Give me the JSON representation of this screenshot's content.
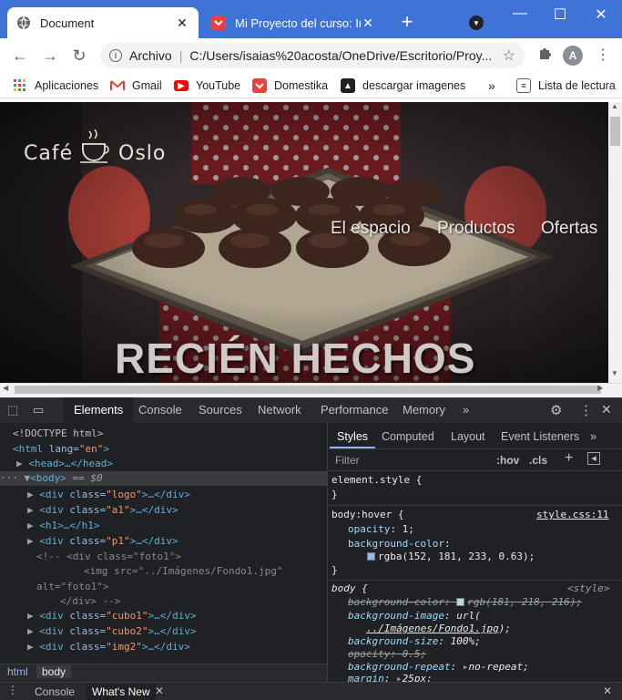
{
  "browser": {
    "tabs": [
      {
        "title": "Document",
        "active": true
      },
      {
        "title": "Mi Proyecto del curso: Intro",
        "active": false
      }
    ],
    "address": {
      "scheme_label": "Archivo",
      "url": "C:/Users/isaias%20acosta/OneDrive/Escritorio/Proy..."
    },
    "avatar_letter": "A",
    "bookmarks": [
      {
        "label": "Aplicaciones",
        "icon": "apps-grid-icon"
      },
      {
        "label": "Gmail",
        "icon": "gmail-icon"
      },
      {
        "label": "YouTube",
        "icon": "youtube-icon"
      },
      {
        "label": "Domestika",
        "icon": "domestika-icon"
      },
      {
        "label": "descargar imagenes",
        "icon": "download-icon"
      }
    ],
    "more_bookmarks": "»",
    "reading_list": "Lista de lectura"
  },
  "page": {
    "logo_left": "Café",
    "logo_right": "Oslo",
    "nav": [
      "El espacio",
      "Productos",
      "Ofertas"
    ],
    "hero": "RECIÉN HECHOS"
  },
  "devtools": {
    "tabs": [
      "Elements",
      "Console",
      "Sources",
      "Network",
      "Performance",
      "Memory"
    ],
    "more": "»",
    "dom": {
      "doctype": "<!DOCTYPE html>",
      "html_open": {
        "tag": "<html",
        "attr": " lang=",
        "val": "\"en\"",
        "close": ">"
      },
      "head": "<head>…</head>",
      "body_open": "<body>",
      "body_suffix": " == $0",
      "div_logo": {
        "attr": "logo"
      },
      "div_a1": {
        "attr": "a1"
      },
      "h1": "<h1>…</h1>",
      "div_p1": {
        "attr": "p1"
      },
      "comment1": "<!-- <div class=\"foto1\">",
      "comment2": "<img src=\"../Imágenes/Fondo1.jpg\"",
      "comment3": "alt=\"foto1\">",
      "comment4": "</div> -->",
      "div_cubo1": {
        "attr": "cubo1"
      },
      "div_cubo2": {
        "attr": "cubo2"
      },
      "div_img2": {
        "attr": "img2"
      }
    },
    "breadcrumbs": [
      "html",
      "body"
    ],
    "styles": {
      "tabs": [
        "Styles",
        "Computed",
        "Layout",
        "Event Listeners"
      ],
      "filter_placeholder": "Filter",
      "hov": ":hov",
      "cls": ".cls",
      "element_style": "element.style {",
      "rule1": {
        "selector": "body:hover {",
        "source": "style.css:11",
        "props": [
          {
            "name": "opacity",
            "value": "1;"
          },
          {
            "name": "background-color",
            "value": "rgba(152, 181, 233, 0.63);",
            "swatch": "#98b5e9"
          }
        ]
      },
      "rule2": {
        "selector": "body {",
        "source": "<style>",
        "props": [
          {
            "name": "background-color",
            "value": "rgb(181, 218, 216);",
            "struck": true,
            "swatch": "#b5dad8"
          },
          {
            "name": "background-image",
            "value": "url("
          },
          {
            "name": "",
            "value": "../Imágenes/Fondo1.jpg"
          },
          {
            "name": "background-size",
            "value": "100%;"
          },
          {
            "name": "opacity",
            "value": "0.5;",
            "struck": true
          },
          {
            "name": "background-repeat",
            "value": "no-repeat;"
          },
          {
            "name": "margin",
            "value": "25px;"
          }
        ]
      }
    },
    "drawer_tabs": [
      "Console",
      "What's New"
    ]
  },
  "colors": {
    "titlebar": "#3f73d8",
    "devtools_bg": "#202124",
    "tag": "#5db0d7",
    "attr_value": "#f29766"
  }
}
